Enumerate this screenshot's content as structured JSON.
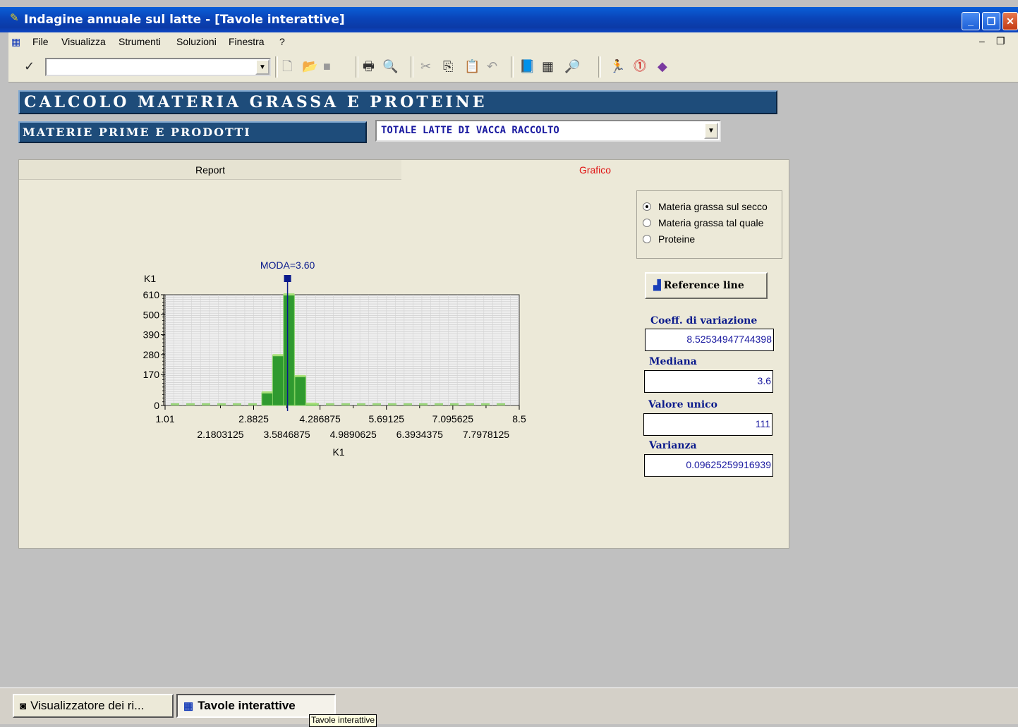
{
  "window": {
    "title": "Indagine annuale sul latte - [Tavole interattive]"
  },
  "menu": [
    "File",
    "Visualizza",
    "Strumenti",
    "Soluzioni",
    "Finestra",
    "?"
  ],
  "toolbar": {
    "combo_value": "",
    "icons": [
      "check-icon",
      "new-icon",
      "open-icon",
      "save-icon",
      "print-icon",
      "print-preview-icon",
      "cut-icon",
      "copy-icon",
      "paste-icon",
      "undo-icon",
      "book-icon",
      "table-icon",
      "find-icon",
      "run-icon",
      "info-icon",
      "help-icon"
    ]
  },
  "banner": {
    "title": "CALCOLO MATERIA GRASSA E PROTEINE",
    "subtitle": "MATERIE PRIME E PRODOTTI",
    "selected_product": "TOTALE LATTE DI VACCA RACCOLTO"
  },
  "tabs": {
    "report": "Report",
    "grafico": "Grafico",
    "active": "grafico"
  },
  "options": {
    "items": [
      "Materia grassa sul secco",
      "Materia grassa tal quale",
      "Proteine"
    ],
    "selected": 0
  },
  "reference_button": "Reference line",
  "stats": {
    "coeff_label": "Coeff. di variazione",
    "coeff_value": "8.52534947744398",
    "mediana_label": "Mediana",
    "mediana_value": "3.6",
    "valore_label": "Valore unico",
    "valore_value": "111",
    "varianza_label": "Varianza",
    "varianza_value": "0.09625259916939"
  },
  "chart_data": {
    "type": "bar",
    "title": "",
    "ylabel": "K1",
    "xlabel": "K1",
    "ylim": [
      0,
      610
    ],
    "xlim": [
      1.01,
      8.5
    ],
    "yticks": [
      "0",
      "170",
      "280",
      "390",
      "500",
      "610"
    ],
    "ytick_values": [
      0,
      170,
      280,
      390,
      500,
      610
    ],
    "xticks_row1": [
      "1.01",
      "2.8825",
      "4.286875",
      "5.69125",
      "7.095625",
      "8.5"
    ],
    "xticks_row1_values": [
      1.01,
      2.8825,
      4.286875,
      5.69125,
      7.095625,
      8.5
    ],
    "xticks_row2": [
      "2.1803125",
      "3.5846875",
      "4.9890625",
      "6.3934375",
      "7.7978125"
    ],
    "xticks_row2_values": [
      2.1803125,
      3.5846875,
      4.9890625,
      6.3934375,
      7.7978125
    ],
    "bars": [
      {
        "x": 3.17,
        "y": 70
      },
      {
        "x": 3.4,
        "y": 275
      },
      {
        "x": 3.63,
        "y": 610
      },
      {
        "x": 3.87,
        "y": 160
      },
      {
        "x": 4.1,
        "y": 8
      }
    ],
    "moda_label": "MODA=3.60",
    "moda_value": 3.6,
    "bar_color": "#2f9a2f",
    "marker_color": "#0a1a8c"
  },
  "taskbar": {
    "task1": "Visualizzatore dei ri...",
    "task2": "Tavole interattive",
    "tooltip": "Tavole interattive"
  }
}
